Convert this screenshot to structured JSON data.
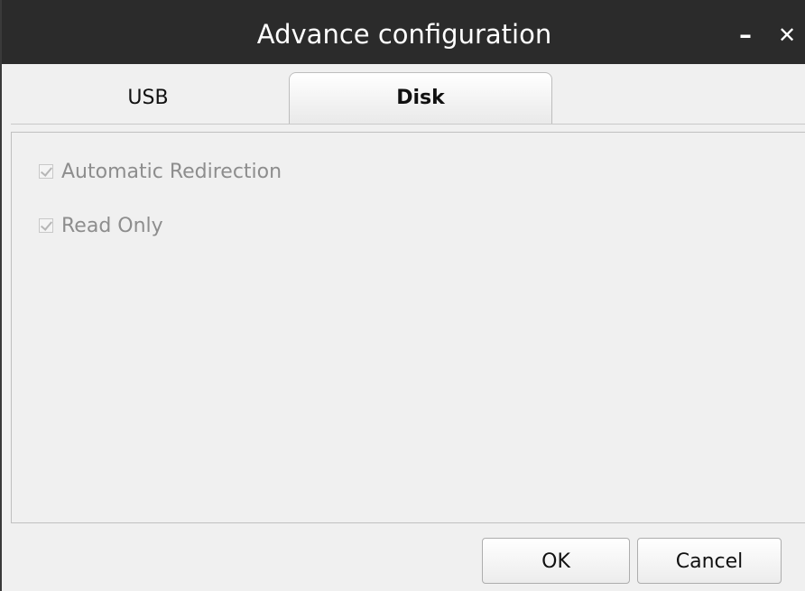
{
  "window": {
    "title": "Advance configuration",
    "minimize_glyph": "–",
    "close_glyph": "✕"
  },
  "tabs": [
    {
      "label": "USB",
      "selected": false
    },
    {
      "label": "Disk",
      "selected": true
    }
  ],
  "options": [
    {
      "label": "Automatic Redirection",
      "checked": true,
      "enabled": false
    },
    {
      "label": "Read Only",
      "checked": true,
      "enabled": false
    }
  ],
  "buttons": {
    "ok_label": "OK",
    "cancel_label": "Cancel"
  },
  "colors": {
    "titlebar": "#2b2b2b",
    "background": "#f0f0f0",
    "disabled_text": "#8d8d8d"
  }
}
